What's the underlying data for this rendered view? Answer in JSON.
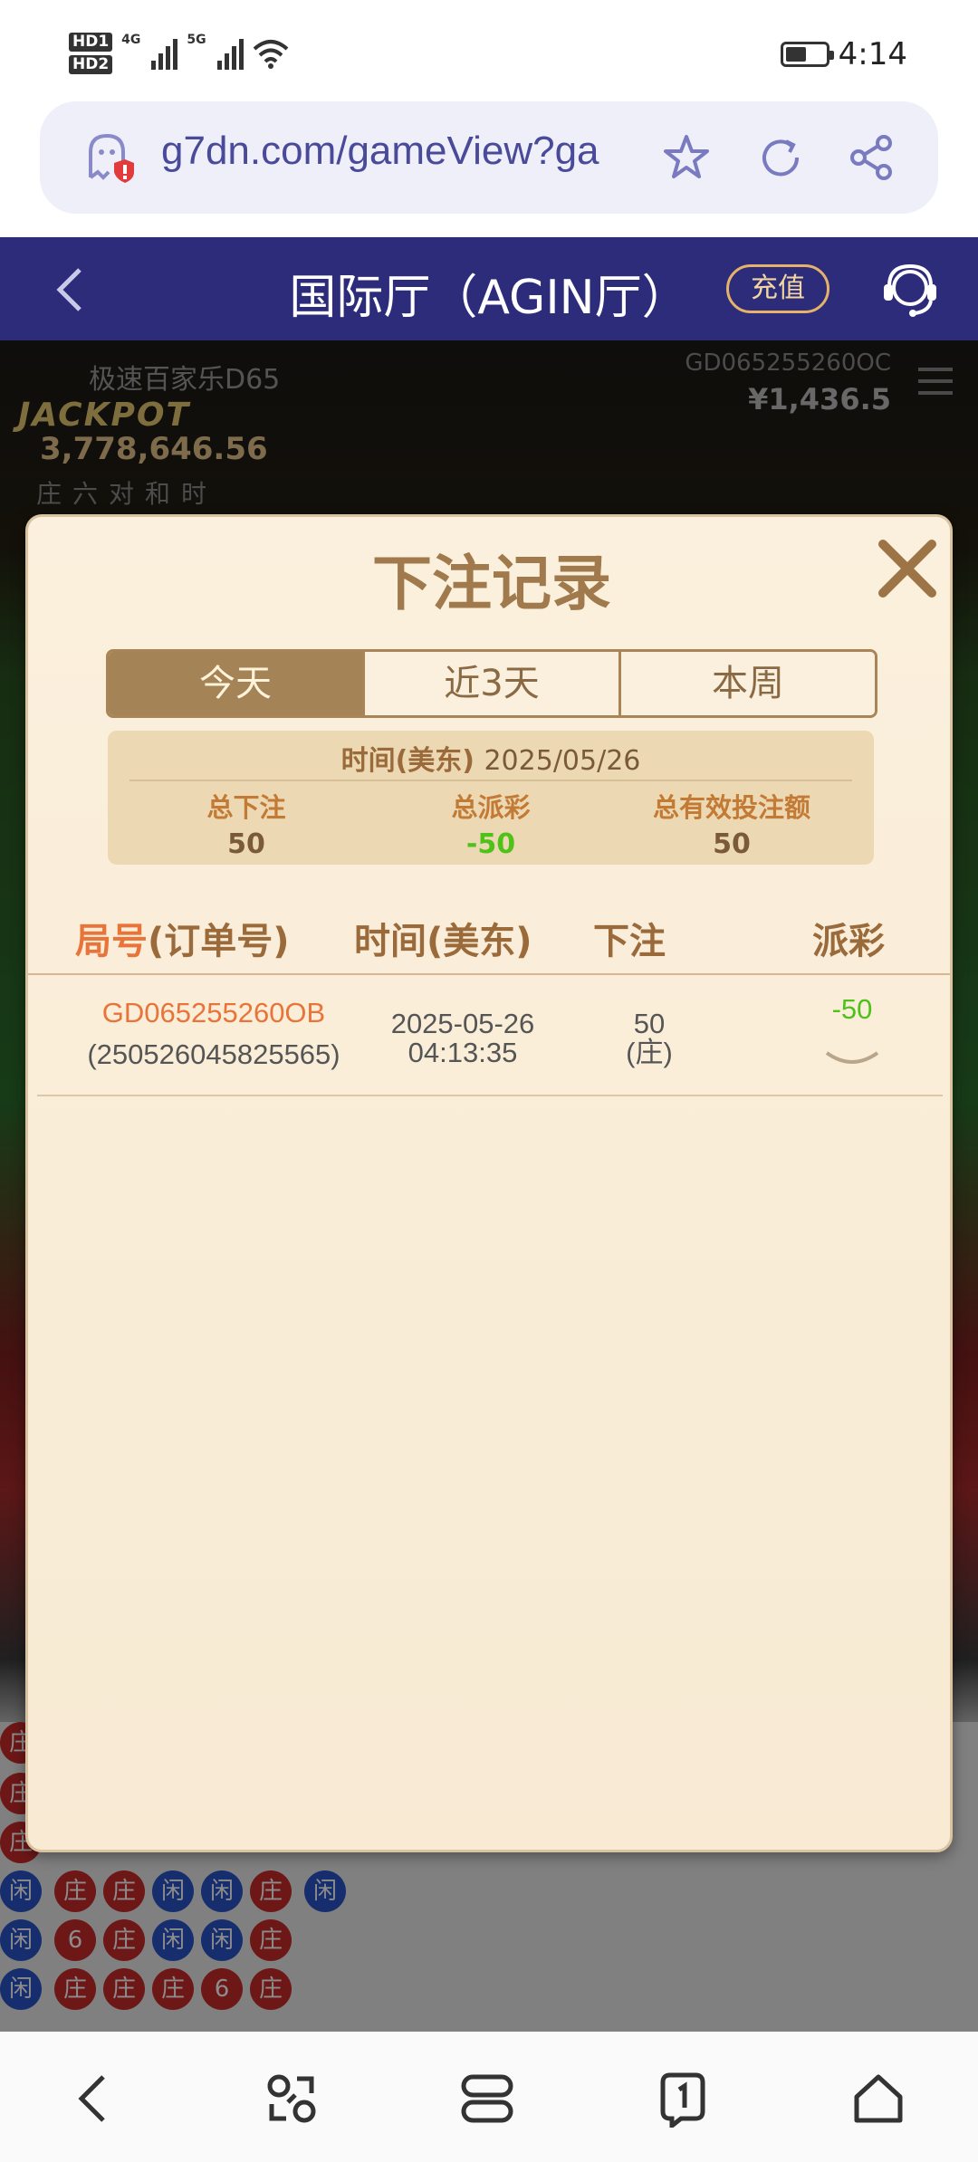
{
  "status_bar": {
    "time": "4:14",
    "network_4g": "4G",
    "network_5g": "5G",
    "hd1": "HD1",
    "hd2": "HD2"
  },
  "browser": {
    "url": "g7dn.com/gameView?ga"
  },
  "header": {
    "title": "国际厅（AGIN厅）",
    "recharge_label": "充值"
  },
  "game": {
    "game_name": "极速百家乐D65",
    "jackpot_label": "JACKPOT",
    "jackpot_value": "3,778,646.56",
    "bet_tags": "庄六对和时",
    "game_id": "GD065255260OC",
    "balance": "¥1,436.5"
  },
  "roadmap": {
    "banker": "庄",
    "player": "闲",
    "six": "6"
  },
  "modal": {
    "title": "下注记录",
    "tabs": [
      {
        "label": "今天",
        "active": true
      },
      {
        "label": "近3天",
        "active": false
      },
      {
        "label": "本周",
        "active": false
      }
    ],
    "summary": {
      "date_label": "时间(美东)",
      "date_value": "2025/05/26",
      "total_bet_label": "总下注",
      "total_bet_value": "50",
      "total_payout_label": "总派彩",
      "total_payout_value": "-50",
      "valid_bet_label": "总有效投注额",
      "valid_bet_value": "50"
    },
    "table": {
      "headers": {
        "round_hl": "局号",
        "round_rest": "(订单号)",
        "time": "时间(美东)",
        "bet": "下注",
        "payout": "派彩"
      },
      "rows": [
        {
          "round": "GD065255260OB",
          "order": "(250526045825565)",
          "date": "2025-05-26",
          "time": "04:13:35",
          "bet": "50",
          "bet_side": "(庄)",
          "payout": "-50"
        }
      ]
    }
  },
  "colors": {
    "header_bg": "#2c2c7a",
    "tab_active": "#a48356",
    "accent_orange": "#e8743a",
    "payout_green": "#4fc21a"
  }
}
